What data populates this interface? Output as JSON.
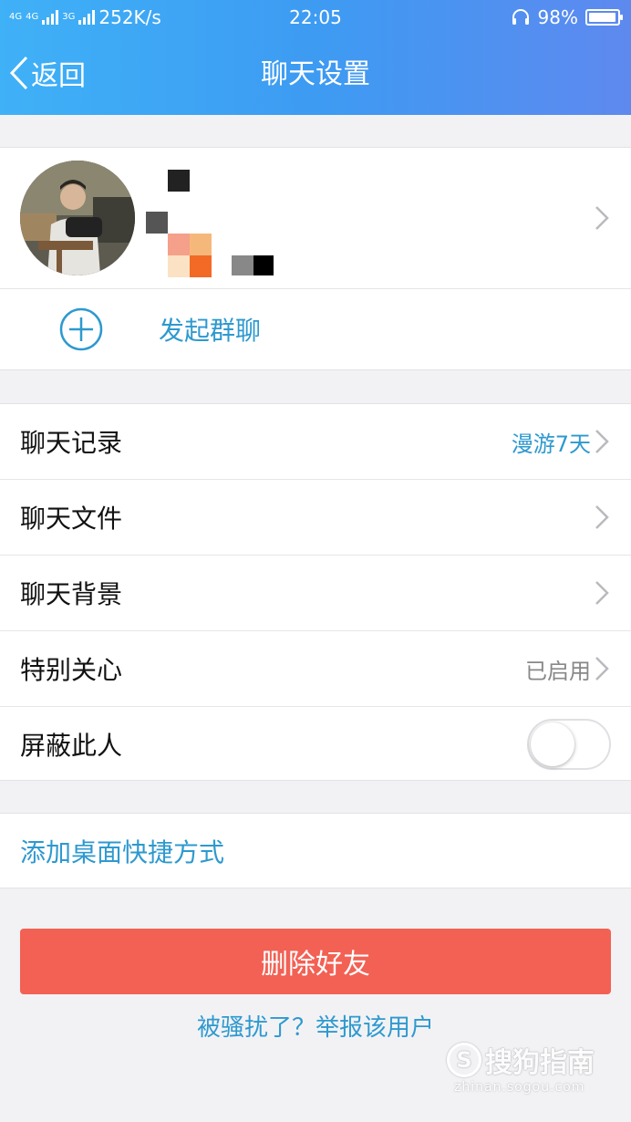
{
  "status_bar": {
    "network_label_1": "4G",
    "network_label_2": "4G",
    "network_label_3": "3G",
    "speed": "252K/s",
    "time": "22:05",
    "battery": "98%",
    "battery_level": 0.98
  },
  "nav": {
    "back_label": "返回",
    "title": "聊天设置"
  },
  "profile": {
    "start_group_chat": "发起群聊"
  },
  "settings": {
    "chat_history": {
      "label": "聊天记录",
      "value": "漫游7天"
    },
    "chat_files": {
      "label": "聊天文件"
    },
    "chat_background": {
      "label": "聊天背景"
    },
    "special_care": {
      "label": "特别关心",
      "value": "已启用"
    },
    "block_user": {
      "label": "屏蔽此人",
      "toggle_on": false
    }
  },
  "add_shortcut": "添加桌面快捷方式",
  "delete_friend": "删除好友",
  "report_user": "被骚扰了？举报该用户",
  "watermark": {
    "brand": "搜狗指南",
    "site": "zhinan.sogou.com",
    "logo_letter": "S"
  },
  "colors": {
    "header_gradient_start": "#3fb1f7",
    "header_gradient_end": "#5e89ef",
    "accent_blue": "#2e99cf",
    "delete_red": "#f26154",
    "background": "#f2f2f5"
  }
}
